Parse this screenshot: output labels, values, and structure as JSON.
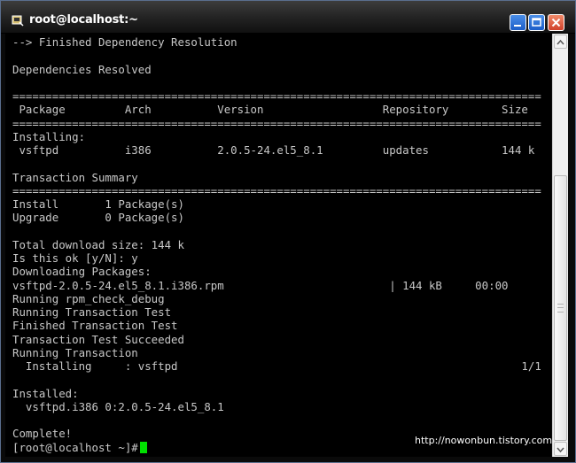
{
  "window": {
    "title": "root@localhost:~",
    "accent": "#1b5dc8",
    "close_color": "#d0412a"
  },
  "icons": {
    "app": "terminal-icon",
    "minimize": "minimize-icon",
    "maximize": "maximize-icon",
    "close": "close-icon",
    "scroll_up": "arrow-up-icon",
    "scroll_down": "arrow-down-icon"
  },
  "terminal": {
    "lines": [
      "--> Finished Dependency Resolution",
      "",
      "Dependencies Resolved",
      "",
      "================================================================================",
      " Package         Arch          Version                  Repository        Size",
      "================================================================================",
      "Installing:",
      " vsftpd          i386          2.0.5-24.el5_8.1         updates           144 k",
      "",
      "Transaction Summary",
      "================================================================================",
      "Install       1 Package(s)",
      "Upgrade       0 Package(s)",
      "",
      "Total download size: 144 k",
      "Is this ok [y/N]: y",
      "Downloading Packages:",
      "vsftpd-2.0.5-24.el5_8.1.i386.rpm                         | 144 kB     00:00",
      "Running rpm_check_debug",
      "Running Transaction Test",
      "Finished Transaction Test",
      "Transaction Test Succeeded",
      "Running Transaction",
      "  Installing     : vsftpd                                                    1/1",
      "",
      "Installed:",
      "  vsftpd.i386 0:2.0.5-24.el5_8.1",
      "",
      "Complete!"
    ],
    "prompt": "[root@localhost ~]# ",
    "text_color": "#c8c8c8",
    "cursor_color": "#00e000"
  },
  "watermark": "http://nowonbun.tistory.com",
  "scrollbar": {
    "position_fraction": 0.9
  }
}
